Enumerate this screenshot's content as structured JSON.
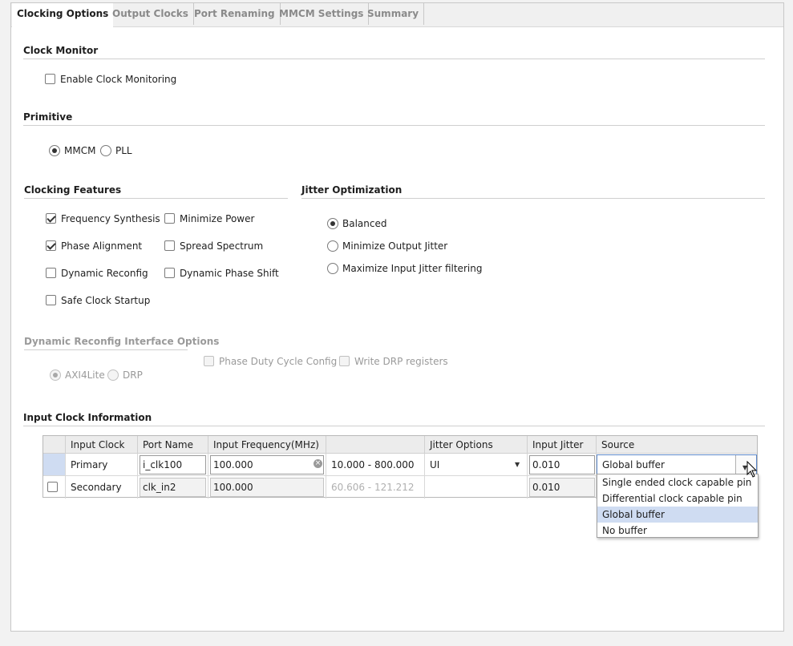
{
  "tabs": [
    "Clocking Options",
    "Output Clocks",
    "Port Renaming",
    "MMCM Settings",
    "Summary"
  ],
  "clock_monitor": {
    "title": "Clock Monitor",
    "enable_label": "Enable Clock Monitoring",
    "enabled": false
  },
  "primitive": {
    "title": "Primitive",
    "options": [
      "MMCM",
      "PLL"
    ],
    "selected": "MMCM"
  },
  "clocking_features": {
    "title": "Clocking Features",
    "items": [
      {
        "label": "Frequency Synthesis",
        "checked": true
      },
      {
        "label": "Minimize Power",
        "checked": false
      },
      {
        "label": "Phase Alignment",
        "checked": true
      },
      {
        "label": "Spread Spectrum",
        "checked": false
      },
      {
        "label": "Dynamic Reconfig",
        "checked": false
      },
      {
        "label": "Dynamic Phase Shift",
        "checked": false
      },
      {
        "label": "Safe Clock Startup",
        "checked": false
      }
    ]
  },
  "jitter_optimization": {
    "title": "Jitter Optimization",
    "options": [
      "Balanced",
      "Minimize Output Jitter",
      "Maximize Input Jitter filtering"
    ],
    "selected": "Balanced"
  },
  "drp_options": {
    "title": "Dynamic Reconfig Interface Options",
    "radios": [
      "AXI4Lite",
      "DRP"
    ],
    "selected": "AXI4Lite",
    "checks": [
      "Phase Duty Cycle Config",
      "Write DRP registers"
    ]
  },
  "input_clock": {
    "title": "Input Clock Information",
    "headers": [
      "Input Clock",
      "Port Name",
      "Input Frequency(MHz)",
      "",
      "Jitter Options",
      "Input Jitter",
      "Source"
    ],
    "rows": [
      {
        "clock": "Primary",
        "port": "i_clk100",
        "freq": "100.000",
        "range": "10.000 - 800.000",
        "jitter_option": "UI",
        "jitter": "0.010",
        "source": "Global buffer"
      },
      {
        "clock": "Secondary",
        "port": "clk_in2",
        "freq": "100.000",
        "range": "60.606 - 121.212",
        "jitter_option": "",
        "jitter": "0.010",
        "source": ""
      }
    ]
  },
  "source_dropdown": {
    "options": [
      "Single ended clock capable pin",
      "Differential clock capable pin",
      "Global buffer",
      "No buffer"
    ],
    "selected": "Global buffer"
  }
}
